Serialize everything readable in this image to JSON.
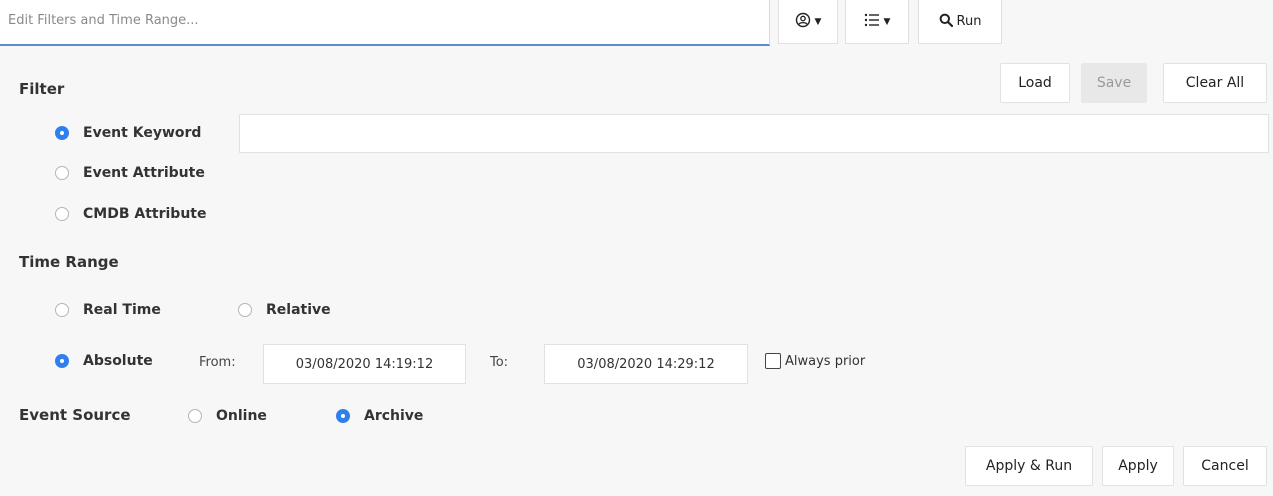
{
  "topbar": {
    "search_placeholder": "Edit Filters and Time Range...",
    "user_icon": "user-circle-icon",
    "list_icon": "list-icon",
    "run_label": "Run",
    "run_icon": "search-icon"
  },
  "filter": {
    "title": "Filter",
    "load_label": "Load",
    "save_label": "Save",
    "clear_label": "Clear All",
    "options": [
      "Event Keyword",
      "Event Attribute",
      "CMDB Attribute"
    ],
    "selected": "Event Keyword",
    "keyword_value": ""
  },
  "time_range": {
    "title": "Time Range",
    "options": [
      "Real Time",
      "Relative",
      "Absolute"
    ],
    "selected": "Absolute",
    "from_label": "From:",
    "from_value": "03/08/2020 14:19:12",
    "to_label": "To:",
    "to_value": "03/08/2020 14:29:12",
    "always_prior_label": "Always prior",
    "always_prior_checked": false
  },
  "event_source": {
    "title": "Event Source",
    "options": [
      "Online",
      "Archive"
    ],
    "selected": "Archive"
  },
  "footer": {
    "apply_run_label": "Apply & Run",
    "apply_label": "Apply",
    "cancel_label": "Cancel"
  },
  "colors": {
    "accent": "#2f80ed",
    "search_underline": "#5a8ec8",
    "disabled_bg": "#e8e8e8"
  }
}
